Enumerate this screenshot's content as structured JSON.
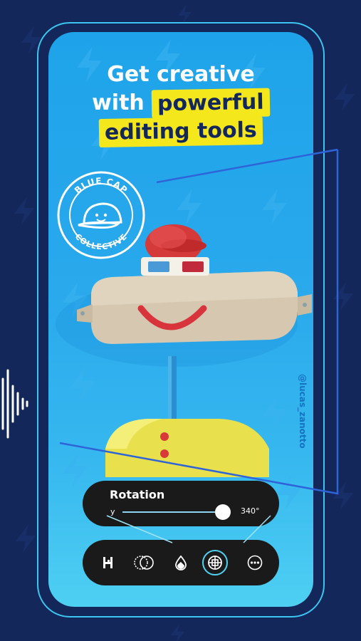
{
  "headline": {
    "line1": "Get creative",
    "line2_prefix": "with",
    "line2_highlight": "powerful",
    "line3_highlight": "editing tools"
  },
  "badge": {
    "top_text": "BLUE CAP",
    "bottom_text": "COLLECTIVE"
  },
  "watermark": "@lucas_zanotto",
  "rotation_panel": {
    "title": "Rotation",
    "axis": "y",
    "value_label": "340°",
    "slider_fraction": 0.94
  },
  "toolbar": {
    "tools": [
      {
        "name": "adjust",
        "icon": "h-adjust-icon"
      },
      {
        "name": "blend",
        "icon": "overlap-circles-icon"
      },
      {
        "name": "color",
        "icon": "droplet-icon"
      },
      {
        "name": "transform",
        "icon": "globe-crosshair-icon",
        "active": true
      },
      {
        "name": "more",
        "icon": "more-dots-icon"
      }
    ]
  },
  "colors": {
    "background": "#14275a",
    "screen_top": "#1ea3ea",
    "screen_bottom": "#4ed0f3",
    "highlight": "#f4e71c",
    "accent": "#3ac6f0",
    "panel": "#1a1a1a"
  }
}
